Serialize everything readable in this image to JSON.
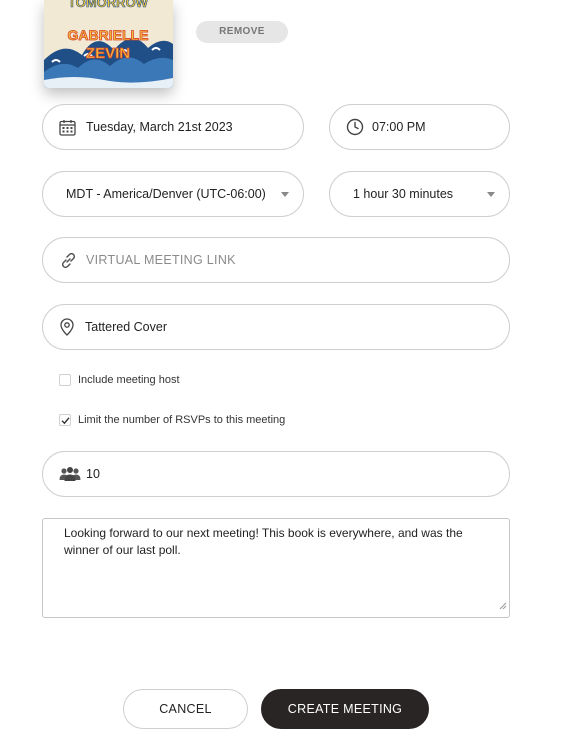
{
  "book_cover": {
    "title_text": "TOMORROW",
    "author_line1": "GABRIELLE",
    "author_line2": "ZEVIN",
    "colors": {
      "background": "#f2e9d4",
      "wave_blue": "#1f4f86",
      "title_yellow": "#f3c53a",
      "author_red": "#d9442c"
    }
  },
  "remove_label": "REMOVE",
  "date": {
    "value": "Tuesday, March 21st 2023",
    "icon": "calendar-icon"
  },
  "time": {
    "value": "07:00 PM",
    "icon": "clock-icon"
  },
  "timezone": {
    "selected": "MDT - America/Denver (UTC-06:00)"
  },
  "duration": {
    "selected": "1 hour 30 minutes"
  },
  "virtual_link": {
    "placeholder": "VIRTUAL MEETING LINK",
    "value": "",
    "icon": "link-icon"
  },
  "location": {
    "value": "Tattered Cover",
    "icon": "location-pin-icon"
  },
  "checkboxes": {
    "include_host": {
      "label": "Include meeting host",
      "checked": false
    },
    "limit_rsvps": {
      "label": "Limit the number of RSVPs to this meeting",
      "checked": true
    }
  },
  "rsvp_limit": {
    "value": "10",
    "icon": "people-icon"
  },
  "description": {
    "value": "Looking forward to our next meeting!  This book is everywhere, and was the winner of our last poll."
  },
  "actions": {
    "cancel_label": "CANCEL",
    "create_label": "CREATE MEETING"
  },
  "colors": {
    "primary_button": "#2a2525",
    "border": "#cfcfcf",
    "placeholder": "#8a8a8a"
  }
}
